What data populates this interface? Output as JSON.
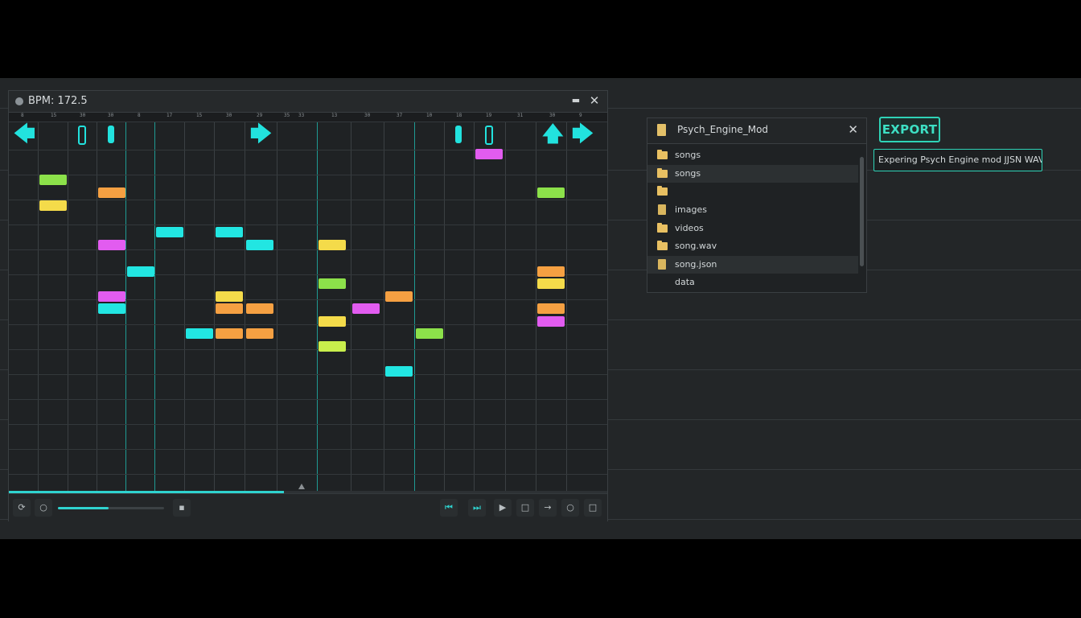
{
  "editor": {
    "title": "BPM: 172.5",
    "minimize_glyph": "▬",
    "close_glyph": "✕",
    "ruler_ticks": [
      "8",
      "15",
      "30",
      "30",
      "8",
      "17",
      "15",
      "30",
      "29",
      "35",
      "33",
      "13",
      "30",
      "37",
      "10",
      "18",
      "19",
      "31",
      "30",
      "9"
    ],
    "lane_icons": [
      {
        "kind": "arrow",
        "icon": "arrow-left-icon",
        "glyph": "🡄"
      },
      {
        "kind": "bar-hollow",
        "icon": "hold-outline-icon"
      },
      {
        "kind": "bar-solid",
        "icon": "hold-solid-icon"
      },
      {
        "kind": "arrow",
        "icon": "arrow-right-icon",
        "glyph": "🡆"
      },
      {
        "kind": "bar-solid",
        "icon": "hold-solid-icon"
      },
      {
        "kind": "bar-hollow",
        "icon": "hold-outline-icon"
      },
      {
        "kind": "arrow",
        "icon": "arrow-up-icon",
        "glyph": "🡅"
      },
      {
        "kind": "arrow",
        "icon": "arrow-right-icon",
        "glyph": "🡆"
      }
    ],
    "note_colors": {
      "green": "#8ce14a",
      "yellow": "#f4db4a",
      "orange": "#f5a042",
      "cyan": "#22e6e2",
      "magenta": "#e25cf0",
      "lime": "#c8ee4c"
    },
    "progress": 0.46,
    "volume": 0.48,
    "transport_icons": [
      "loop-icon",
      "record-icon",
      "settings-icon",
      "skip-back-icon",
      "skip-forward-icon",
      "play-icon",
      "stop-icon",
      "next-icon",
      "circle-icon",
      "square-icon"
    ]
  },
  "browser": {
    "title": "Psych_Engine_Mod",
    "close_glyph": "✕",
    "items": [
      {
        "label": "songs",
        "type": "folder"
      },
      {
        "label": "songs",
        "type": "folder"
      },
      {
        "label": "",
        "type": "folder"
      },
      {
        "label": "images",
        "type": "file"
      },
      {
        "label": "videos",
        "type": "folder"
      },
      {
        "label": "song.wav",
        "type": "folder"
      },
      {
        "label": "song.json",
        "type": "file"
      },
      {
        "label": "data",
        "type": "none"
      }
    ]
  },
  "export": {
    "button_label": "EXPORT",
    "status_text": "Expering Psych Engine mod JJSN WAV..."
  }
}
